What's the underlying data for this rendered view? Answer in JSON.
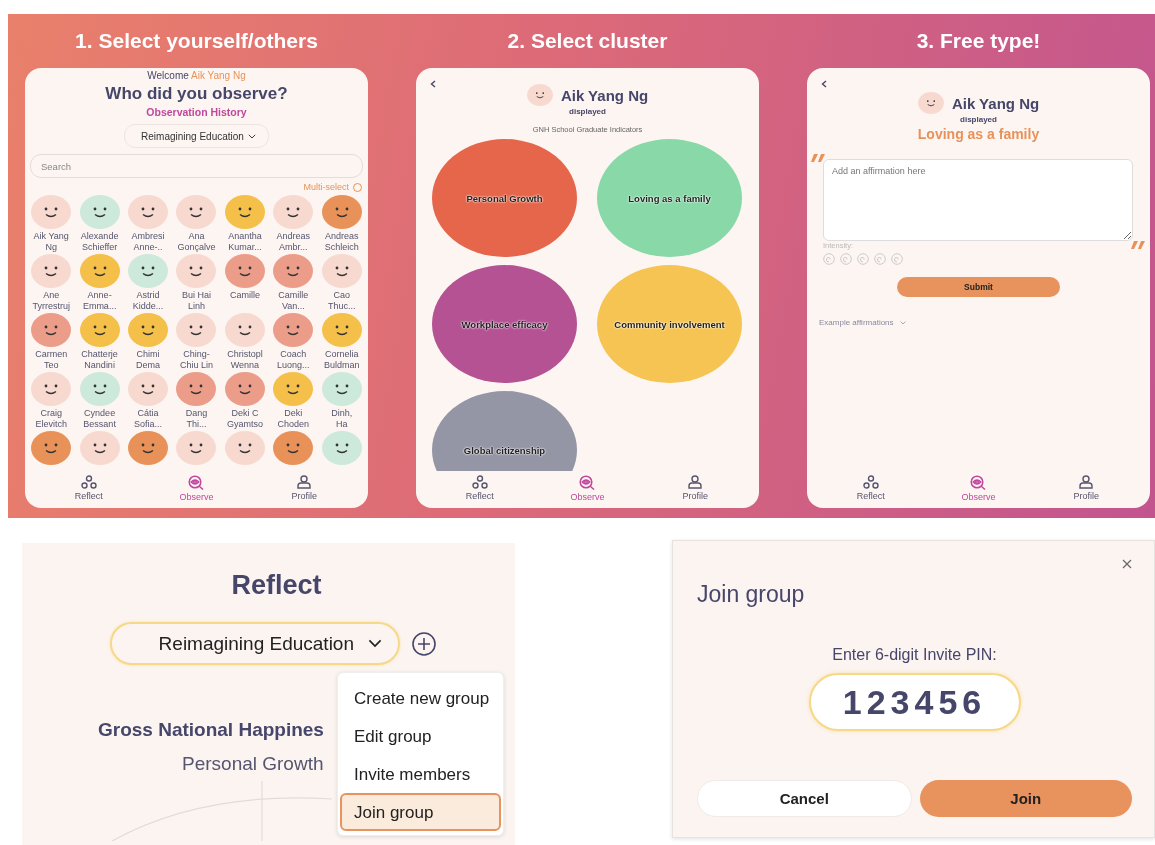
{
  "steps": [
    {
      "kind": "people",
      "heading": "1. Select yourself/others",
      "welcome_label": "Welcome",
      "welcome_name": "Aik Yang Ng",
      "title": "Who did you observe?",
      "history_link": "Observation History",
      "group_select": "Reimagining Education",
      "search": {
        "placeholder": "Search"
      },
      "multi_select": {
        "label": "Multi-select",
        "checked": false
      },
      "people": [
        {
          "name": "Aik Yang\nNg",
          "color": "#f8d9d0"
        },
        {
          "name": "Alexande\nSchieffer",
          "color": "#cde9dc"
        },
        {
          "name": "Ambresi\nAnne-..",
          "color": "#f8d9d0"
        },
        {
          "name": "Ana\nGonçalve",
          "color": "#f8d9d0"
        },
        {
          "name": "Anantha\nKumar...",
          "color": "#f5c04a"
        },
        {
          "name": "Andreas\nAmbr...",
          "color": "#f8d9d0"
        },
        {
          "name": "Andreas\nSchleich",
          "color": "#e8925a"
        },
        {
          "name": "Ane\nTyrrestruj",
          "color": "#f8d9d0"
        },
        {
          "name": "Anne-\nEmma...",
          "color": "#f5c04a"
        },
        {
          "name": "Astrid\nKidde...",
          "color": "#cde9dc"
        },
        {
          "name": "Bui Hai\nLinh",
          "color": "#f8d9d0"
        },
        {
          "name": "Camille",
          "color": "#ec9d8a"
        },
        {
          "name": "Camille\nVan...",
          "color": "#ec9d8a"
        },
        {
          "name": "Cao\nThuc...",
          "color": "#f8d9d0"
        },
        {
          "name": "Carmen\nTeo",
          "color": "#ec9d8a"
        },
        {
          "name": "Chatterje\nNandini",
          "color": "#f5c04a"
        },
        {
          "name": "Chimi\nDema",
          "color": "#f5c04a"
        },
        {
          "name": "Ching-\nChiu Lin",
          "color": "#f8d9d0"
        },
        {
          "name": "Christopl\nWenna",
          "color": "#f8d9d0"
        },
        {
          "name": "Coach\nLuong...",
          "color": "#ec9d8a"
        },
        {
          "name": "Cornelia\nBuldman",
          "color": "#f5c04a"
        },
        {
          "name": "Craig\nElevitch",
          "color": "#f8d9d0"
        },
        {
          "name": "Cyndee\nBessant",
          "color": "#cde9dc"
        },
        {
          "name": "Cátia\nSofia...",
          "color": "#f8d9d0"
        },
        {
          "name": "Dang\nThi...",
          "color": "#ec9d8a"
        },
        {
          "name": "Deki C\nGyamtso",
          "color": "#ec9d8a"
        },
        {
          "name": "Deki\nChoden",
          "color": "#f5c04a"
        },
        {
          "name": "Dinh,\nHa",
          "color": "#cde9dc"
        }
      ],
      "hidden_row": [
        {
          "color": "#e8925a"
        },
        {
          "color": "#f8d9d0"
        },
        {
          "color": "#e8925a"
        },
        {
          "color": "#f8d9d0"
        },
        {
          "color": "#f8d9d0"
        },
        {
          "color": "#e8925a"
        },
        {
          "color": "#cde9dc"
        }
      ],
      "nav": [
        {
          "label": "Reflect",
          "selected": false
        },
        {
          "label": "Observe",
          "selected": true
        },
        {
          "label": "Profile",
          "selected": false
        }
      ]
    },
    {
      "kind": "clusters",
      "heading": "2. Select cluster",
      "person": {
        "name": "Aik Yang Ng",
        "status": "displayed"
      },
      "subtitle": "GNH School Graduate Indicators",
      "clusters": [
        {
          "label": "Personal Growth",
          "color": "#e5664a"
        },
        {
          "label": "Loving as a family",
          "color": "#88d8a8"
        },
        {
          "label": "Workplace efficacy",
          "color": "#b55294"
        },
        {
          "label": "Community involvement",
          "color": "#f5c452"
        },
        {
          "label": "Global citizenship",
          "color": "#9496a5"
        }
      ],
      "nav": [
        {
          "label": "Reflect",
          "selected": false
        },
        {
          "label": "Observe",
          "selected": true
        },
        {
          "label": "Profile",
          "selected": false
        }
      ]
    },
    {
      "kind": "affirmation",
      "heading": "3. Free type!",
      "person": {
        "name": "Aik Yang Ng",
        "status": "displayed"
      },
      "cluster": "Loving as a family",
      "affirmation": {
        "placeholder": "Add an affirmation here"
      },
      "intensity": {
        "label": "Intensity:",
        "stars": 0
      },
      "submit": "Submit",
      "examples": "Example affirmations",
      "nav": [
        {
          "label": "Reflect",
          "selected": false
        },
        {
          "label": "Observe",
          "selected": true
        },
        {
          "label": "Profile",
          "selected": false
        }
      ]
    }
  ],
  "reflect_panel": {
    "title": "Reflect",
    "group_select": "Reimagining Education",
    "heading": "Gross National Happines",
    "subheading": "Personal Growth",
    "menu": [
      {
        "label": "Create new group",
        "selected": false
      },
      {
        "label": "Edit group",
        "selected": false
      },
      {
        "label": "Invite members",
        "selected": false
      },
      {
        "label": "Join group",
        "selected": true
      }
    ]
  },
  "join_dialog": {
    "title": "Join group",
    "pin_label": "Enter 6-digit Invite PIN:",
    "pin": {
      "value": "123456"
    },
    "buttons": [
      {
        "label": "Cancel",
        "kind": "secondary"
      },
      {
        "label": "Join",
        "kind": "primary"
      }
    ]
  }
}
